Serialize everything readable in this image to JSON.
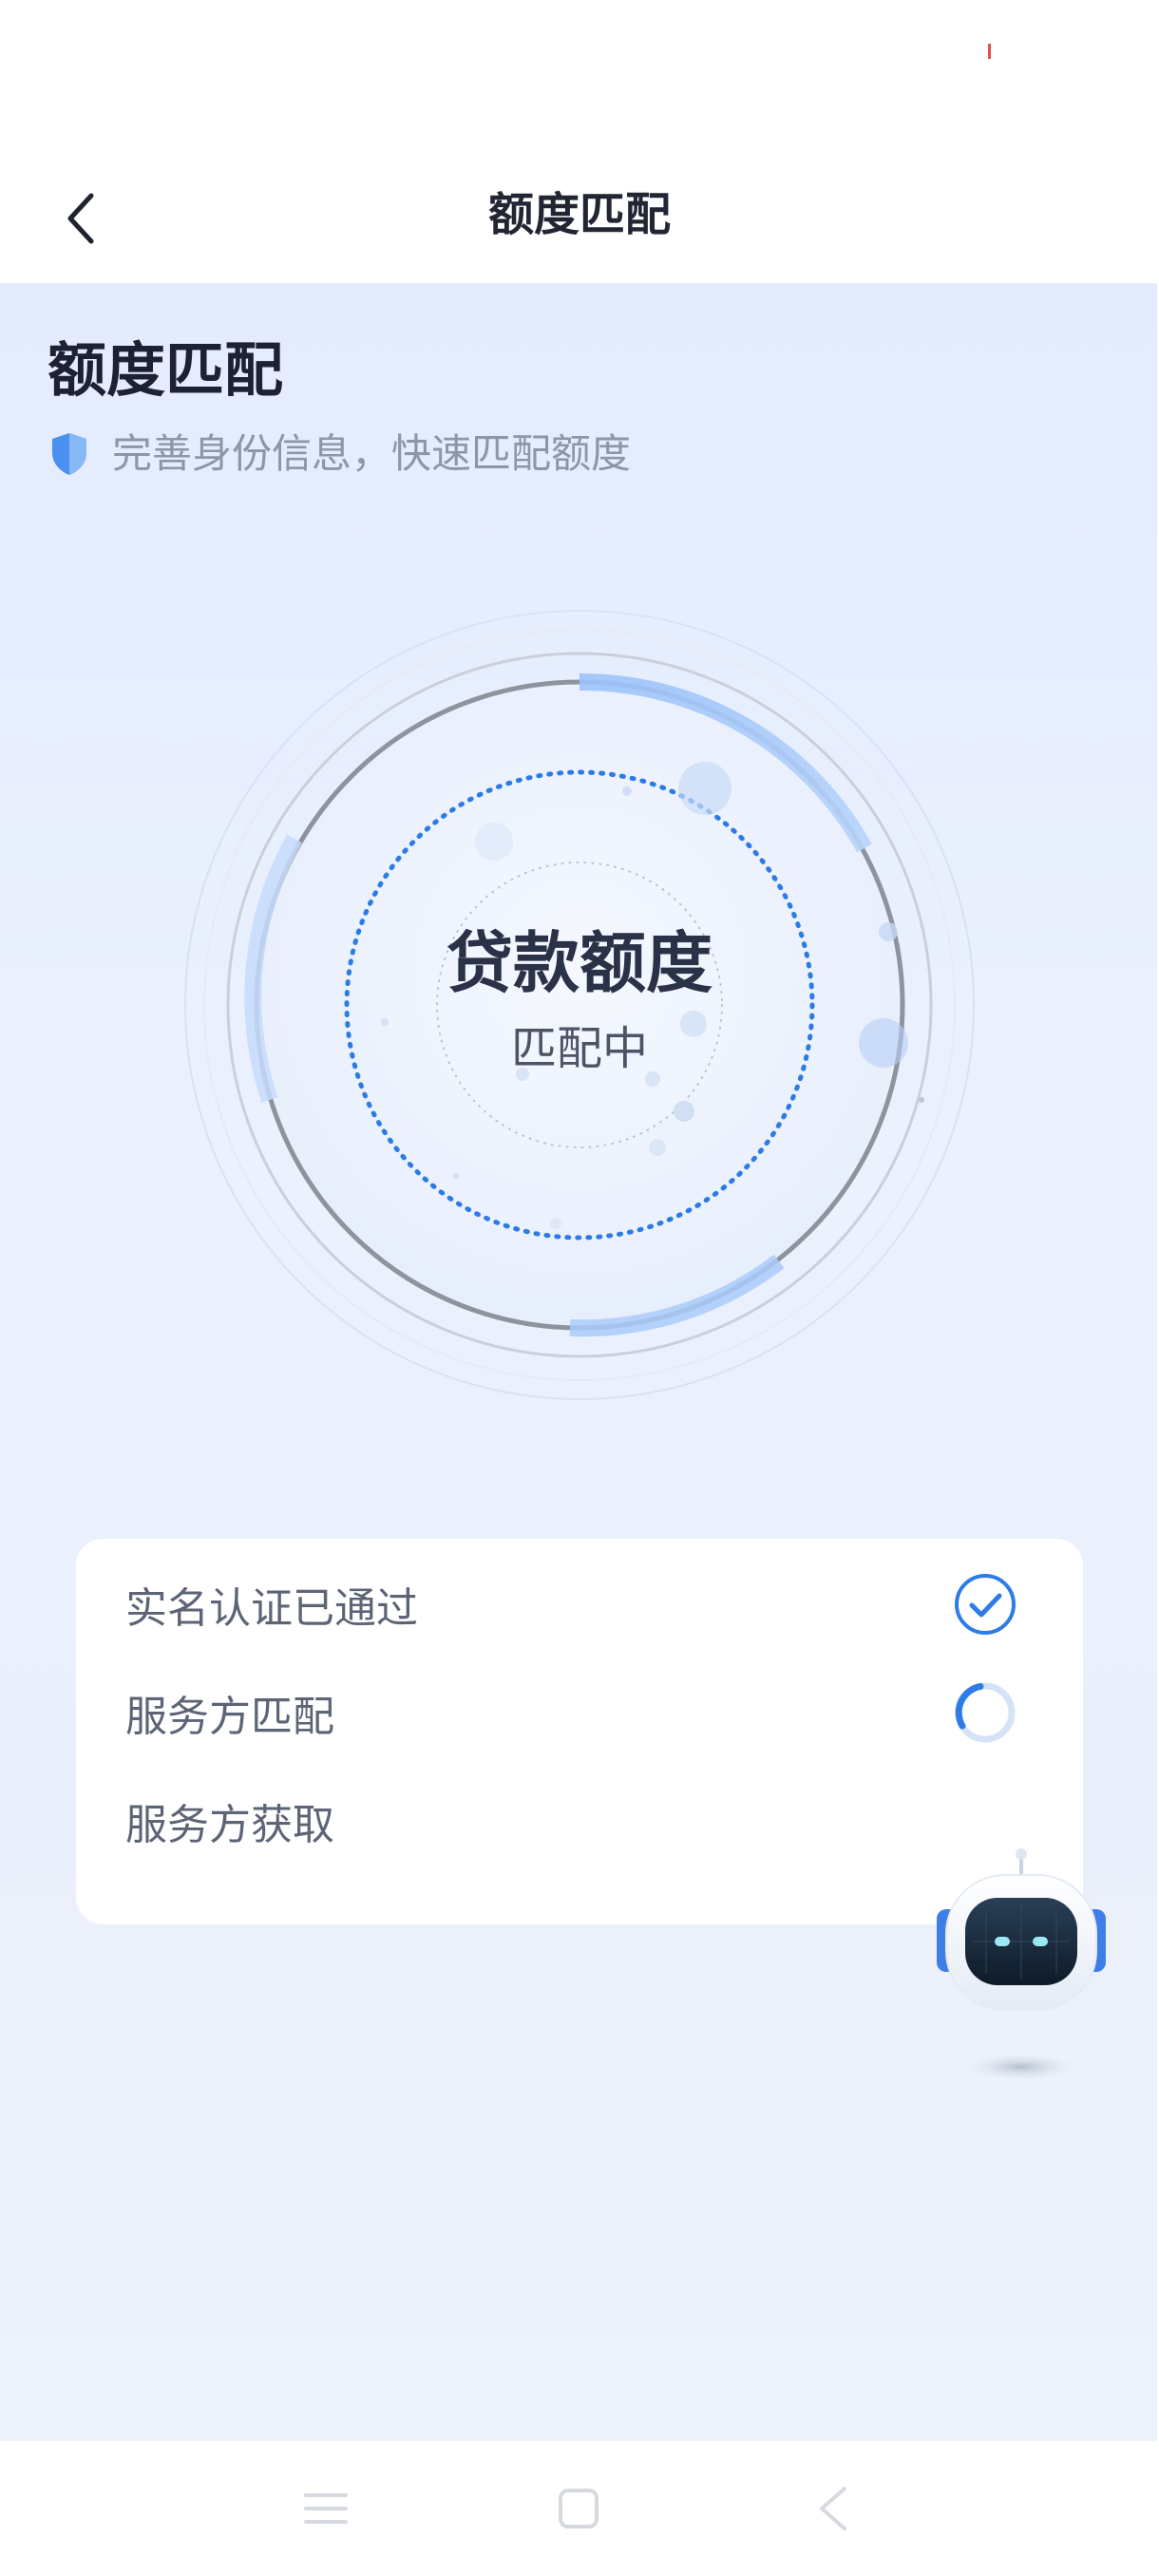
{
  "header": {
    "title": "额度匹配"
  },
  "main": {
    "title": "额度匹配",
    "subtitle": "完善身份信息，快速匹配额度"
  },
  "radar": {
    "title": "贷款额度",
    "status": "匹配中"
  },
  "steps": [
    {
      "label": "实名认证已通过",
      "state": "done",
      "icon": "check-circle-icon"
    },
    {
      "label": "服务方匹配",
      "state": "loading",
      "icon": "spinner-icon"
    },
    {
      "label": "服务方获取",
      "state": "pending",
      "icon": ""
    }
  ],
  "colors": {
    "accent": "#2f7be8",
    "background_top": "#e3ebfd",
    "text_primary": "#1d2233",
    "text_secondary": "#8d95a6"
  },
  "system_nav": {
    "icons": [
      "menu-icon",
      "home-icon",
      "back-icon"
    ]
  }
}
